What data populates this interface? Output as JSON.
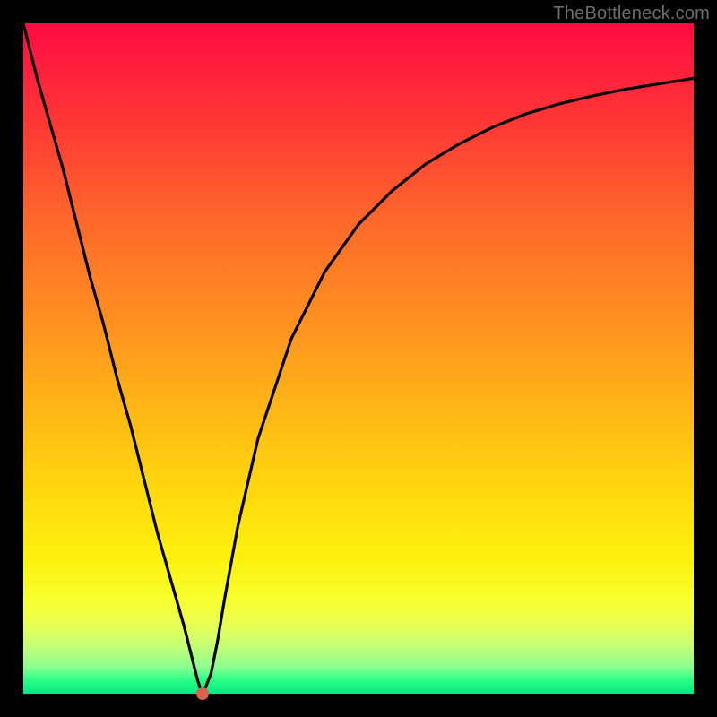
{
  "watermark": "TheBottleneck.com",
  "colors": {
    "frame": "#000000",
    "curve": "#000000",
    "dot": "#d4634f"
  },
  "chart_data": {
    "type": "line",
    "title": "",
    "xlabel": "",
    "ylabel": "",
    "xlim": [
      0,
      100
    ],
    "ylim": [
      0,
      100
    ],
    "series": [
      {
        "name": "bottleneck-curve",
        "x": [
          0,
          2,
          4,
          6,
          8,
          10,
          12,
          14,
          16,
          18,
          20,
          22,
          24,
          25,
          26,
          26.5,
          27,
          28,
          29,
          30,
          32,
          35,
          40,
          45,
          50,
          55,
          60,
          65,
          70,
          75,
          80,
          85,
          90,
          95,
          100
        ],
        "values": [
          100,
          92,
          85,
          78,
          70,
          62,
          55,
          47,
          40,
          32,
          24,
          17,
          10,
          6,
          2,
          0.5,
          0.5,
          3,
          8,
          14,
          25,
          38,
          53,
          63,
          70,
          75,
          79,
          82,
          84.5,
          86.5,
          88,
          89.2,
          90.2,
          91,
          91.8
        ]
      }
    ],
    "marker": {
      "x": 26.8,
      "y": 0
    },
    "annotations": []
  }
}
